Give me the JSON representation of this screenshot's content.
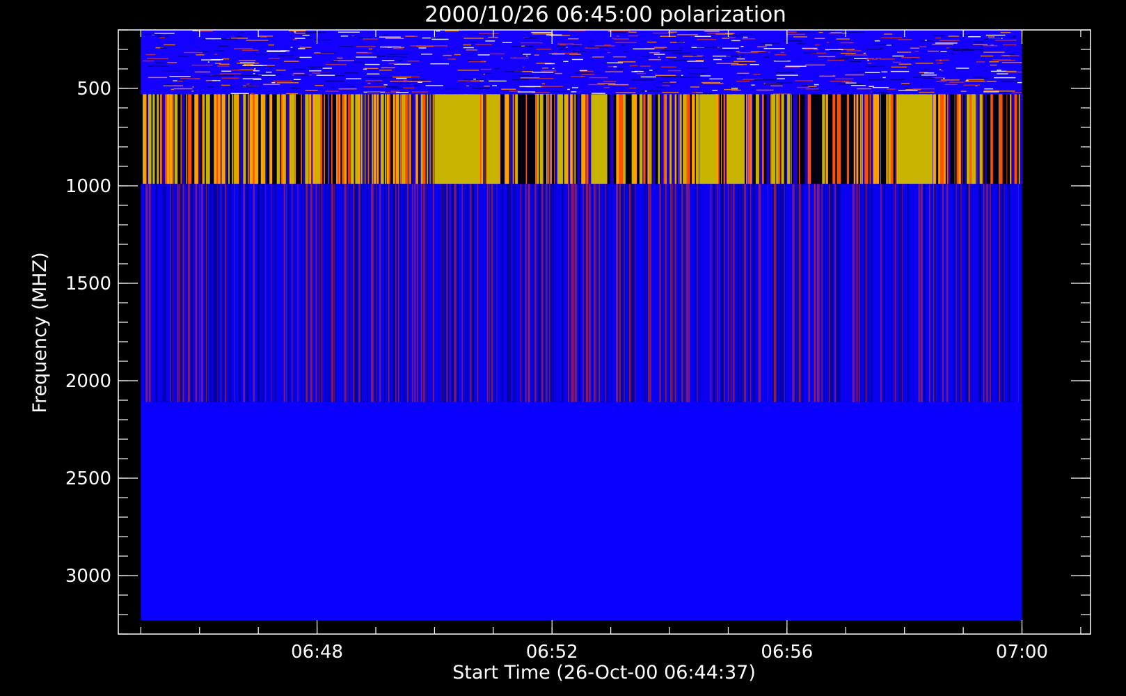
{
  "chart_data": {
    "type": "heatmap",
    "title": "2000/10/26 06:45:00 polarization",
    "xlabel": "Start Time (26-Oct-00 06:44:37)",
    "ylabel": "Frequency (MHZ)",
    "x_range": [
      "06:44:37",
      "07:01:10"
    ],
    "x_data_extent": [
      "06:45:00",
      "07:00:00"
    ],
    "y_range": [
      200,
      3300
    ],
    "y_data_extent": [
      200,
      3200
    ],
    "y_reversed": true,
    "x_ticks": [
      "06:48",
      "06:52",
      "06:56",
      "07:00"
    ],
    "y_ticks": [
      500,
      1000,
      1500,
      2000,
      2500,
      3000
    ],
    "bands": [
      {
        "freq_range": [
          200,
          530
        ],
        "pattern": "noise",
        "base_color": "#1400ff",
        "accent_colors": [
          "#c83232",
          "#ff8800",
          "#ffffff",
          "#000080"
        ]
      },
      {
        "freq_range": [
          530,
          990
        ],
        "pattern": "stripes",
        "base_color": "#000010",
        "accent_colors": [
          "#c8b400",
          "#ffa000",
          "#ff5000",
          "#1e00c8"
        ]
      },
      {
        "freq_range": [
          990,
          2110
        ],
        "pattern": "stripes",
        "base_color": "#0a00f0",
        "accent_colors": [
          "#0000a0",
          "#8c1e78",
          "#a01e3c",
          "#00008c"
        ]
      },
      {
        "freq_range": [
          2110,
          3230
        ],
        "pattern": "uniform",
        "base_color": "#0a00ff",
        "accent_colors": [
          "#1200ff"
        ]
      }
    ],
    "grid": false,
    "legend": "none"
  }
}
